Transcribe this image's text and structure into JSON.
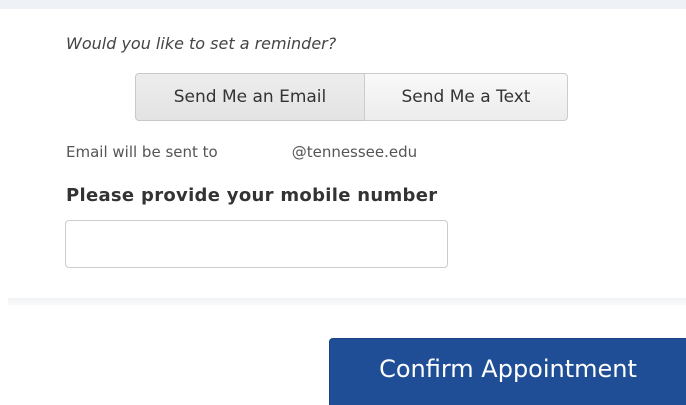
{
  "reminder": {
    "question": "Would you like to set a reminder?",
    "email_button": "Send Me an Email",
    "text_button": "Send Me a Text",
    "email_note_prefix": "Email will be sent to",
    "email_note_domain": "@tennessee.edu"
  },
  "mobile": {
    "label": "Please provide your mobile number",
    "value": "",
    "placeholder": ""
  },
  "actions": {
    "confirm_label": "Confirm Appointment"
  },
  "colors": {
    "primary_button": "#1f4e96",
    "toggle_background": "#f3f3f3",
    "panel_shadow": "#eef2f6"
  }
}
